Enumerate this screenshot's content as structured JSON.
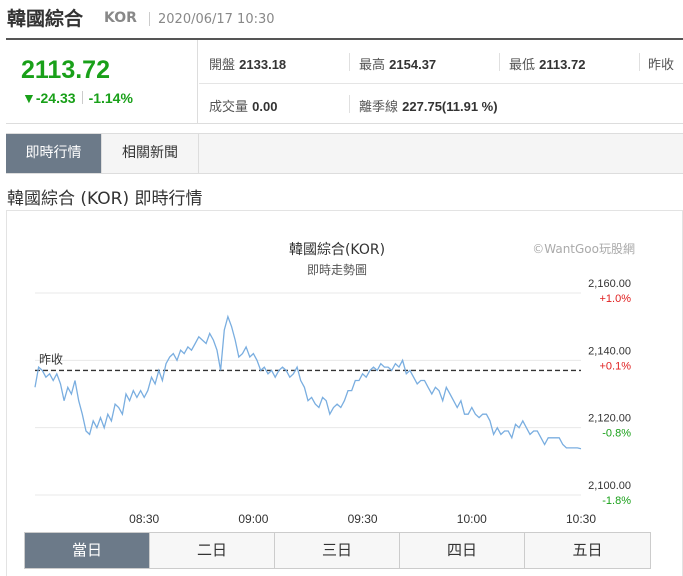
{
  "header": {
    "name": "韓國綜合",
    "symbol": "KOR",
    "datetime": "2020/06/17 10:30"
  },
  "quote": {
    "price": "2113.72",
    "change": "▼-24.33",
    "change_pct": "-1.14%",
    "open_label": "開盤",
    "open": "2133.18",
    "high_label": "最高",
    "high": "2154.37",
    "low_label": "最低",
    "low": "2113.72",
    "prev_label": "昨收",
    "volume_label": "成交量",
    "volume": "0.00",
    "season_label": "離季線",
    "season": "227.75(11.91 %)",
    "down_color": "#19a019",
    "up_color": "#e02020"
  },
  "tabs": [
    {
      "label": "即時行情",
      "active": true
    },
    {
      "label": "相關新聞",
      "active": false
    }
  ],
  "section_title": "韓國綜合 (KOR) 即時行情",
  "chart_data": {
    "type": "line",
    "title": "韓國綜合(KOR)",
    "subtitle": "即時走勢圖",
    "watermark": "©WantGoo玩股網",
    "ref_label": "昨收",
    "ref_value": 2137.0,
    "x_ticks": [
      "08:30",
      "09:00",
      "09:30",
      "10:00",
      "10:30"
    ],
    "y_ticks": [
      {
        "value": 2160,
        "label": "2,160.00",
        "pct": "+1.0%"
      },
      {
        "value": 2140,
        "label": "2,140.00",
        "pct": "+0.1%"
      },
      {
        "value": 2120,
        "label": "2,120.00",
        "pct": "-0.8%"
      },
      {
        "value": 2100,
        "label": "2,100.00",
        "pct": "-1.8%"
      }
    ],
    "ylim": [
      2100,
      2160
    ],
    "x_minutes": [
      0,
      150
    ],
    "series": [
      {
        "line_color": "#7aaee0",
        "x": [
          0,
          1,
          2,
          3,
          4,
          5,
          6,
          7,
          8,
          9,
          10,
          11,
          12,
          13,
          14,
          15,
          16,
          17,
          18,
          19,
          20,
          21,
          22,
          23,
          24,
          25,
          26,
          27,
          28,
          29,
          30,
          31,
          32,
          33,
          34,
          35,
          36,
          37,
          38,
          39,
          40,
          41,
          42,
          43,
          44,
          45,
          46,
          47,
          48,
          49,
          50,
          51,
          52,
          53,
          54,
          55,
          56,
          57,
          58,
          59,
          60,
          61,
          62,
          63,
          64,
          65,
          66,
          67,
          68,
          69,
          70,
          71,
          72,
          73,
          74,
          75,
          76,
          77,
          78,
          79,
          80,
          81,
          82,
          83,
          84,
          85,
          86,
          87,
          88,
          89,
          90,
          91,
          92,
          93,
          94,
          95,
          96,
          97,
          98,
          99,
          100,
          101,
          102,
          103,
          104,
          105,
          106,
          107,
          108,
          109,
          110,
          111,
          112,
          113,
          114,
          115,
          116,
          117,
          118,
          119,
          120,
          121,
          122,
          123,
          124,
          125,
          126,
          127,
          128,
          129,
          130,
          131,
          132,
          133,
          134,
          135,
          136,
          137,
          138,
          139,
          140,
          141,
          142,
          143,
          144,
          145,
          146,
          147,
          148,
          149,
          150
        ],
        "values": [
          2132,
          2138,
          2137,
          2135,
          2136,
          2134,
          2136,
          2133,
          2128,
          2132,
          2130,
          2134,
          2128,
          2124,
          2119,
          2118,
          2122,
          2120,
          2123,
          2120,
          2124,
          2122,
          2127,
          2126,
          2124,
          2130,
          2128,
          2131,
          2129,
          2131,
          2129,
          2131,
          2135,
          2133,
          2137,
          2134,
          2139,
          2141,
          2142,
          2140,
          2143,
          2142,
          2144,
          2143,
          2145,
          2147,
          2146,
          2145,
          2148,
          2146,
          2143,
          2137,
          2149,
          2153,
          2150,
          2146,
          2141,
          2142,
          2144,
          2141,
          2142,
          2140,
          2137,
          2138,
          2136,
          2137,
          2135,
          2137,
          2138,
          2137,
          2135,
          2136,
          2138,
          2134,
          2132,
          2128,
          2129,
          2127,
          2126,
          2129,
          2128,
          2124,
          2126,
          2127,
          2126,
          2128,
          2131,
          2131,
          2134,
          2134,
          2136,
          2135,
          2137,
          2138,
          2137,
          2139,
          2138,
          2138,
          2137,
          2139,
          2138,
          2140,
          2136,
          2137,
          2135,
          2133,
          2134,
          2134,
          2132,
          2130,
          2132,
          2131,
          2128,
          2132,
          2130,
          2128,
          2126,
          2128,
          2124,
          2124,
          2126,
          2124,
          2123,
          2124,
          2124,
          2122,
          2118,
          2120,
          2118,
          2119,
          2119,
          2117,
          2121,
          2120,
          2122,
          2120,
          2118,
          2119,
          2119,
          2117,
          2115,
          2117,
          2117,
          2117,
          2117,
          2115,
          2114,
          2114,
          2114,
          2114,
          2113.72
        ]
      }
    ]
  },
  "ranges": [
    {
      "label": "當日",
      "active": true
    },
    {
      "label": "二日",
      "active": false
    },
    {
      "label": "三日",
      "active": false
    },
    {
      "label": "四日",
      "active": false
    },
    {
      "label": "五日",
      "active": false
    }
  ]
}
